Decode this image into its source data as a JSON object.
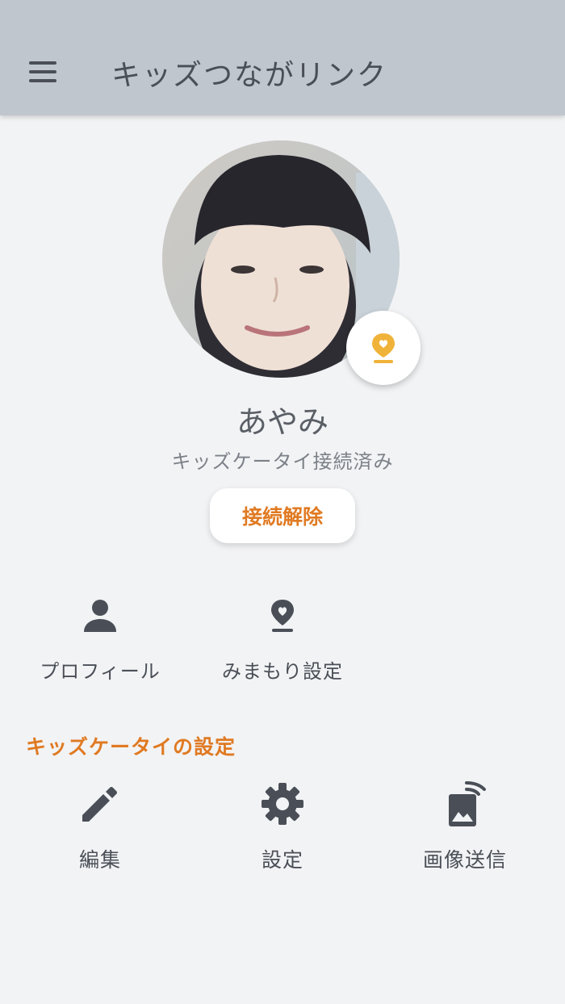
{
  "app": {
    "title": "キッズつながリンク"
  },
  "child": {
    "name": "あやみ",
    "status": "キッズケータイ接続済み",
    "disconnect_label": "接続解除"
  },
  "quick_actions": [
    {
      "label": "プロフィール",
      "icon": "person-icon"
    },
    {
      "label": "みまもり設定",
      "icon": "location-heart-icon"
    }
  ],
  "kids_phone_section": {
    "title": "キッズケータイの設定",
    "items": [
      {
        "label": "編集",
        "icon": "pencil-icon"
      },
      {
        "label": "設定",
        "icon": "gear-icon"
      },
      {
        "label": "画像送信",
        "icon": "image-send-icon"
      }
    ]
  },
  "colors": {
    "appbar": "#c0c6cd",
    "background": "#f2f3f5",
    "accent": "#e07a22",
    "location_badge": "#f0b33a",
    "icon": "#4a4f57"
  }
}
